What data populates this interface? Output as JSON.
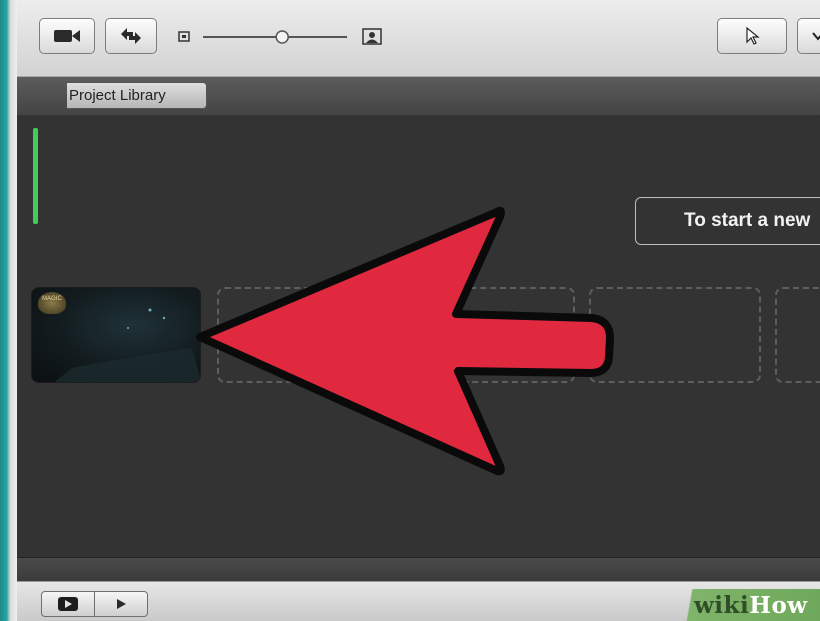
{
  "toolbar": {
    "buttons": [
      {
        "name": "camera-import-icon"
      },
      {
        "name": "swap-rotate-icon"
      }
    ],
    "zoom_slider": {
      "level": 0.55
    },
    "tools": [
      {
        "name": "pointer-arrow-icon"
      },
      {
        "name": "menu-chevron-icon"
      }
    ]
  },
  "library": {
    "back_label": "Project Library"
  },
  "main": {
    "hint_text": "To start a new",
    "slots": [
      {
        "kind": "clip-thumbnail",
        "logo_text": "MAGIC"
      },
      {
        "kind": "empty"
      },
      {
        "kind": "empty"
      },
      {
        "kind": "empty"
      },
      {
        "kind": "empty"
      }
    ]
  },
  "overlay": {
    "arrow_color": "#e0283f",
    "arrow_direction": "left"
  },
  "playback": {
    "buttons": [
      {
        "name": "play-fullscreen-icon"
      },
      {
        "name": "play-icon"
      }
    ]
  },
  "watermark": {
    "part1": "wiki",
    "part2": "How"
  },
  "colors": {
    "accent_green": "#3fcf56",
    "background_dark": "#333333",
    "watermark_green": "#7fb46a"
  }
}
